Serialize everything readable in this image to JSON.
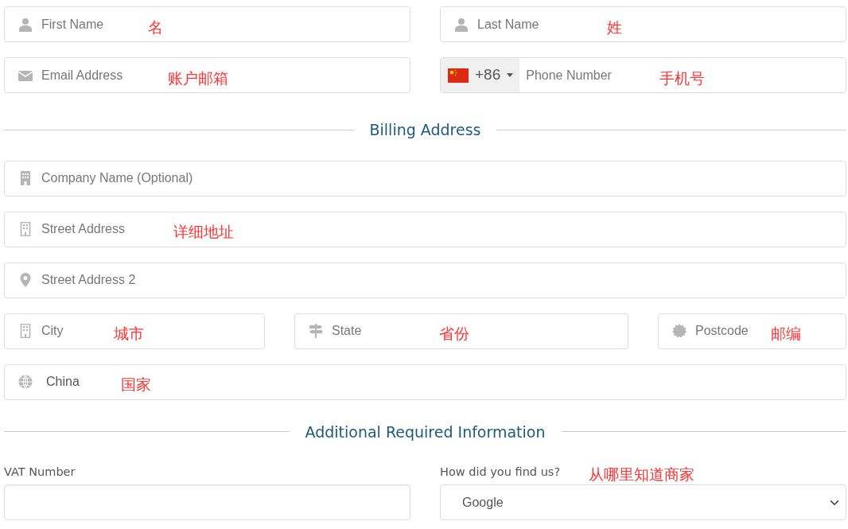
{
  "contact_rows": [
    [
      {
        "kind": "text",
        "placeholder": "First Name",
        "note": "名"
      },
      {
        "kind": "text",
        "placeholder": "Last Name",
        "note": "姓"
      }
    ],
    [
      {
        "kind": "text",
        "placeholder": "Email Address",
        "note": "账户邮箱"
      },
      {
        "kind": "phone",
        "country_code": "+86",
        "placeholder": "Phone Number",
        "note": "手机号"
      }
    ]
  ],
  "billing": {
    "title": "Billing Address",
    "rows": [
      [
        {
          "kind": "text",
          "placeholder": "Company Name (Optional)"
        }
      ],
      [
        {
          "kind": "text",
          "placeholder": "Street Address",
          "note": "详细地址"
        }
      ],
      [
        {
          "kind": "text",
          "placeholder": "Street Address 2"
        }
      ],
      [
        {
          "kind": "text",
          "placeholder": "City",
          "note": "城市"
        },
        {
          "kind": "text",
          "placeholder": "State",
          "note": "省份"
        },
        {
          "kind": "text",
          "placeholder": "Postcode",
          "note": "邮编"
        }
      ],
      [
        {
          "kind": "value",
          "value": "China",
          "note": "国家"
        }
      ]
    ]
  },
  "additional": {
    "title": "Additional Required Information",
    "fields": [
      {
        "kind": "text",
        "label": "VAT Number"
      },
      {
        "kind": "select",
        "label": "How did you find us?",
        "note": "从哪里知道商家",
        "value": "Google"
      }
    ]
  }
}
